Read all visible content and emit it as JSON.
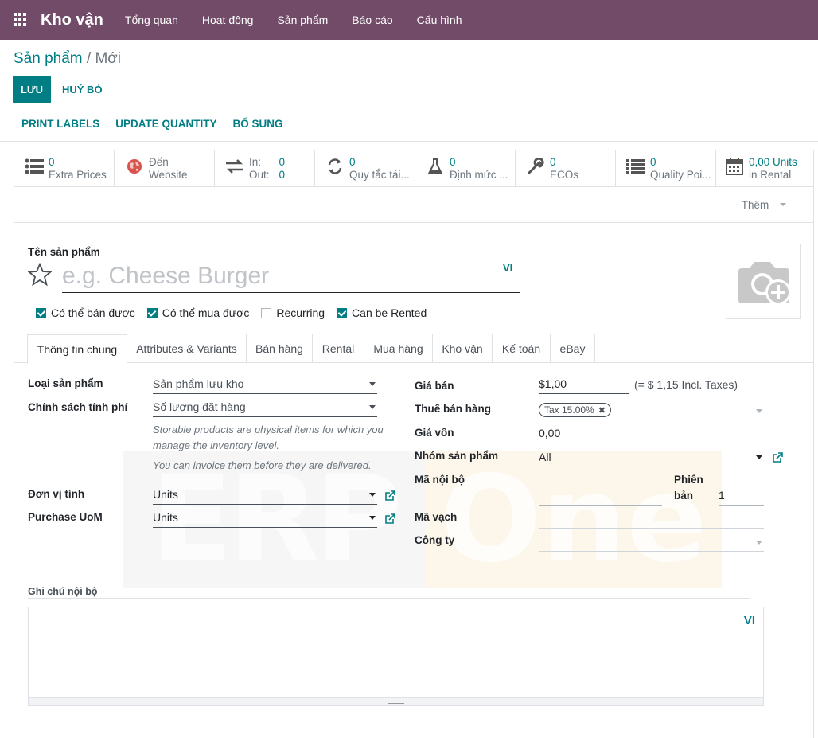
{
  "navbar": {
    "brand": "Kho vận",
    "menu": [
      "Tổng quan",
      "Hoạt động",
      "Sản phẩm",
      "Báo cáo",
      "Cấu hình"
    ]
  },
  "breadcrumb": {
    "parent": "Sản phẩm",
    "separator": "/",
    "current": "Mới"
  },
  "buttons": {
    "save": "LƯU",
    "discard": "HUỶ BỎ"
  },
  "actions": [
    "PRINT LABELS",
    "UPDATE QUANTITY",
    "BỔ SUNG"
  ],
  "smart_buttons": [
    {
      "icon": "list-icon",
      "value": "0",
      "label": "Extra Prices"
    },
    {
      "icon": "globe-icon",
      "value": "Đến",
      "label": "Website"
    },
    {
      "icon": "exchange-icon",
      "in_label": "In:",
      "in_value": "0",
      "out_label": "Out:",
      "out_value": "0"
    },
    {
      "icon": "refresh-icon",
      "value": "0",
      "label": "Quy tắc tái..."
    },
    {
      "icon": "flask-icon",
      "value": "0",
      "label": "Định mức ..."
    },
    {
      "icon": "wrench-icon",
      "value": "0",
      "label": "ECOs"
    },
    {
      "icon": "list-icon",
      "value": "0",
      "label": "Quality Poi..."
    },
    {
      "icon": "calendar-icon",
      "value": "0,00 Units",
      "label": "in Rental"
    }
  ],
  "more_button": "Thêm",
  "product": {
    "name_label": "Tên sản phẩm",
    "name_placeholder": "e.g. Cheese Burger",
    "lang": "VI"
  },
  "checkboxes": [
    {
      "label": "Có thể bán được",
      "checked": true
    },
    {
      "label": "Có thể mua được",
      "checked": true
    },
    {
      "label": "Recurring",
      "checked": false
    },
    {
      "label": "Can be Rented",
      "checked": true
    }
  ],
  "tabs": [
    "Thông tin chung",
    "Attributes & Variants",
    "Bán hàng",
    "Rental",
    "Mua hàng",
    "Kho vận",
    "Kế toán",
    "eBay"
  ],
  "general": {
    "product_type_label": "Loại sản phẩm",
    "product_type_value": "Sản phẩm lưu kho",
    "invoice_policy_label": "Chính sách tính phí",
    "invoice_policy_value": "Số lượng đặt hàng",
    "help1": "Storable products are physical items for which you manage the inventory level.",
    "help2": "You can invoice them before they are delivered.",
    "uom_label": "Đơn vị tính",
    "uom_value": "Units",
    "purchase_uom_label": "Purchase UoM",
    "purchase_uom_value": "Units",
    "sale_price_label": "Giá bán",
    "sale_price_value": "$1,00",
    "sale_price_incl": "(= $ 1,15 Incl. Taxes)",
    "sale_tax_label": "Thuế bán hàng",
    "sale_tax_tag": "Tax 15.00%",
    "cost_label": "Giá vốn",
    "cost_value": "0,00",
    "category_label": "Nhóm sản phẩm",
    "category_value": "All",
    "internal_ref_label": "Mã nội bộ",
    "version_label_1": "Phiên",
    "version_label_2": "bản",
    "version_value": "1",
    "barcode_label": "Mã vạch",
    "company_label": "Công ty",
    "note_label": "Ghi chú nội bộ",
    "note_lang": "VI"
  },
  "watermark": {
    "left": "ERP",
    "right": "One"
  }
}
